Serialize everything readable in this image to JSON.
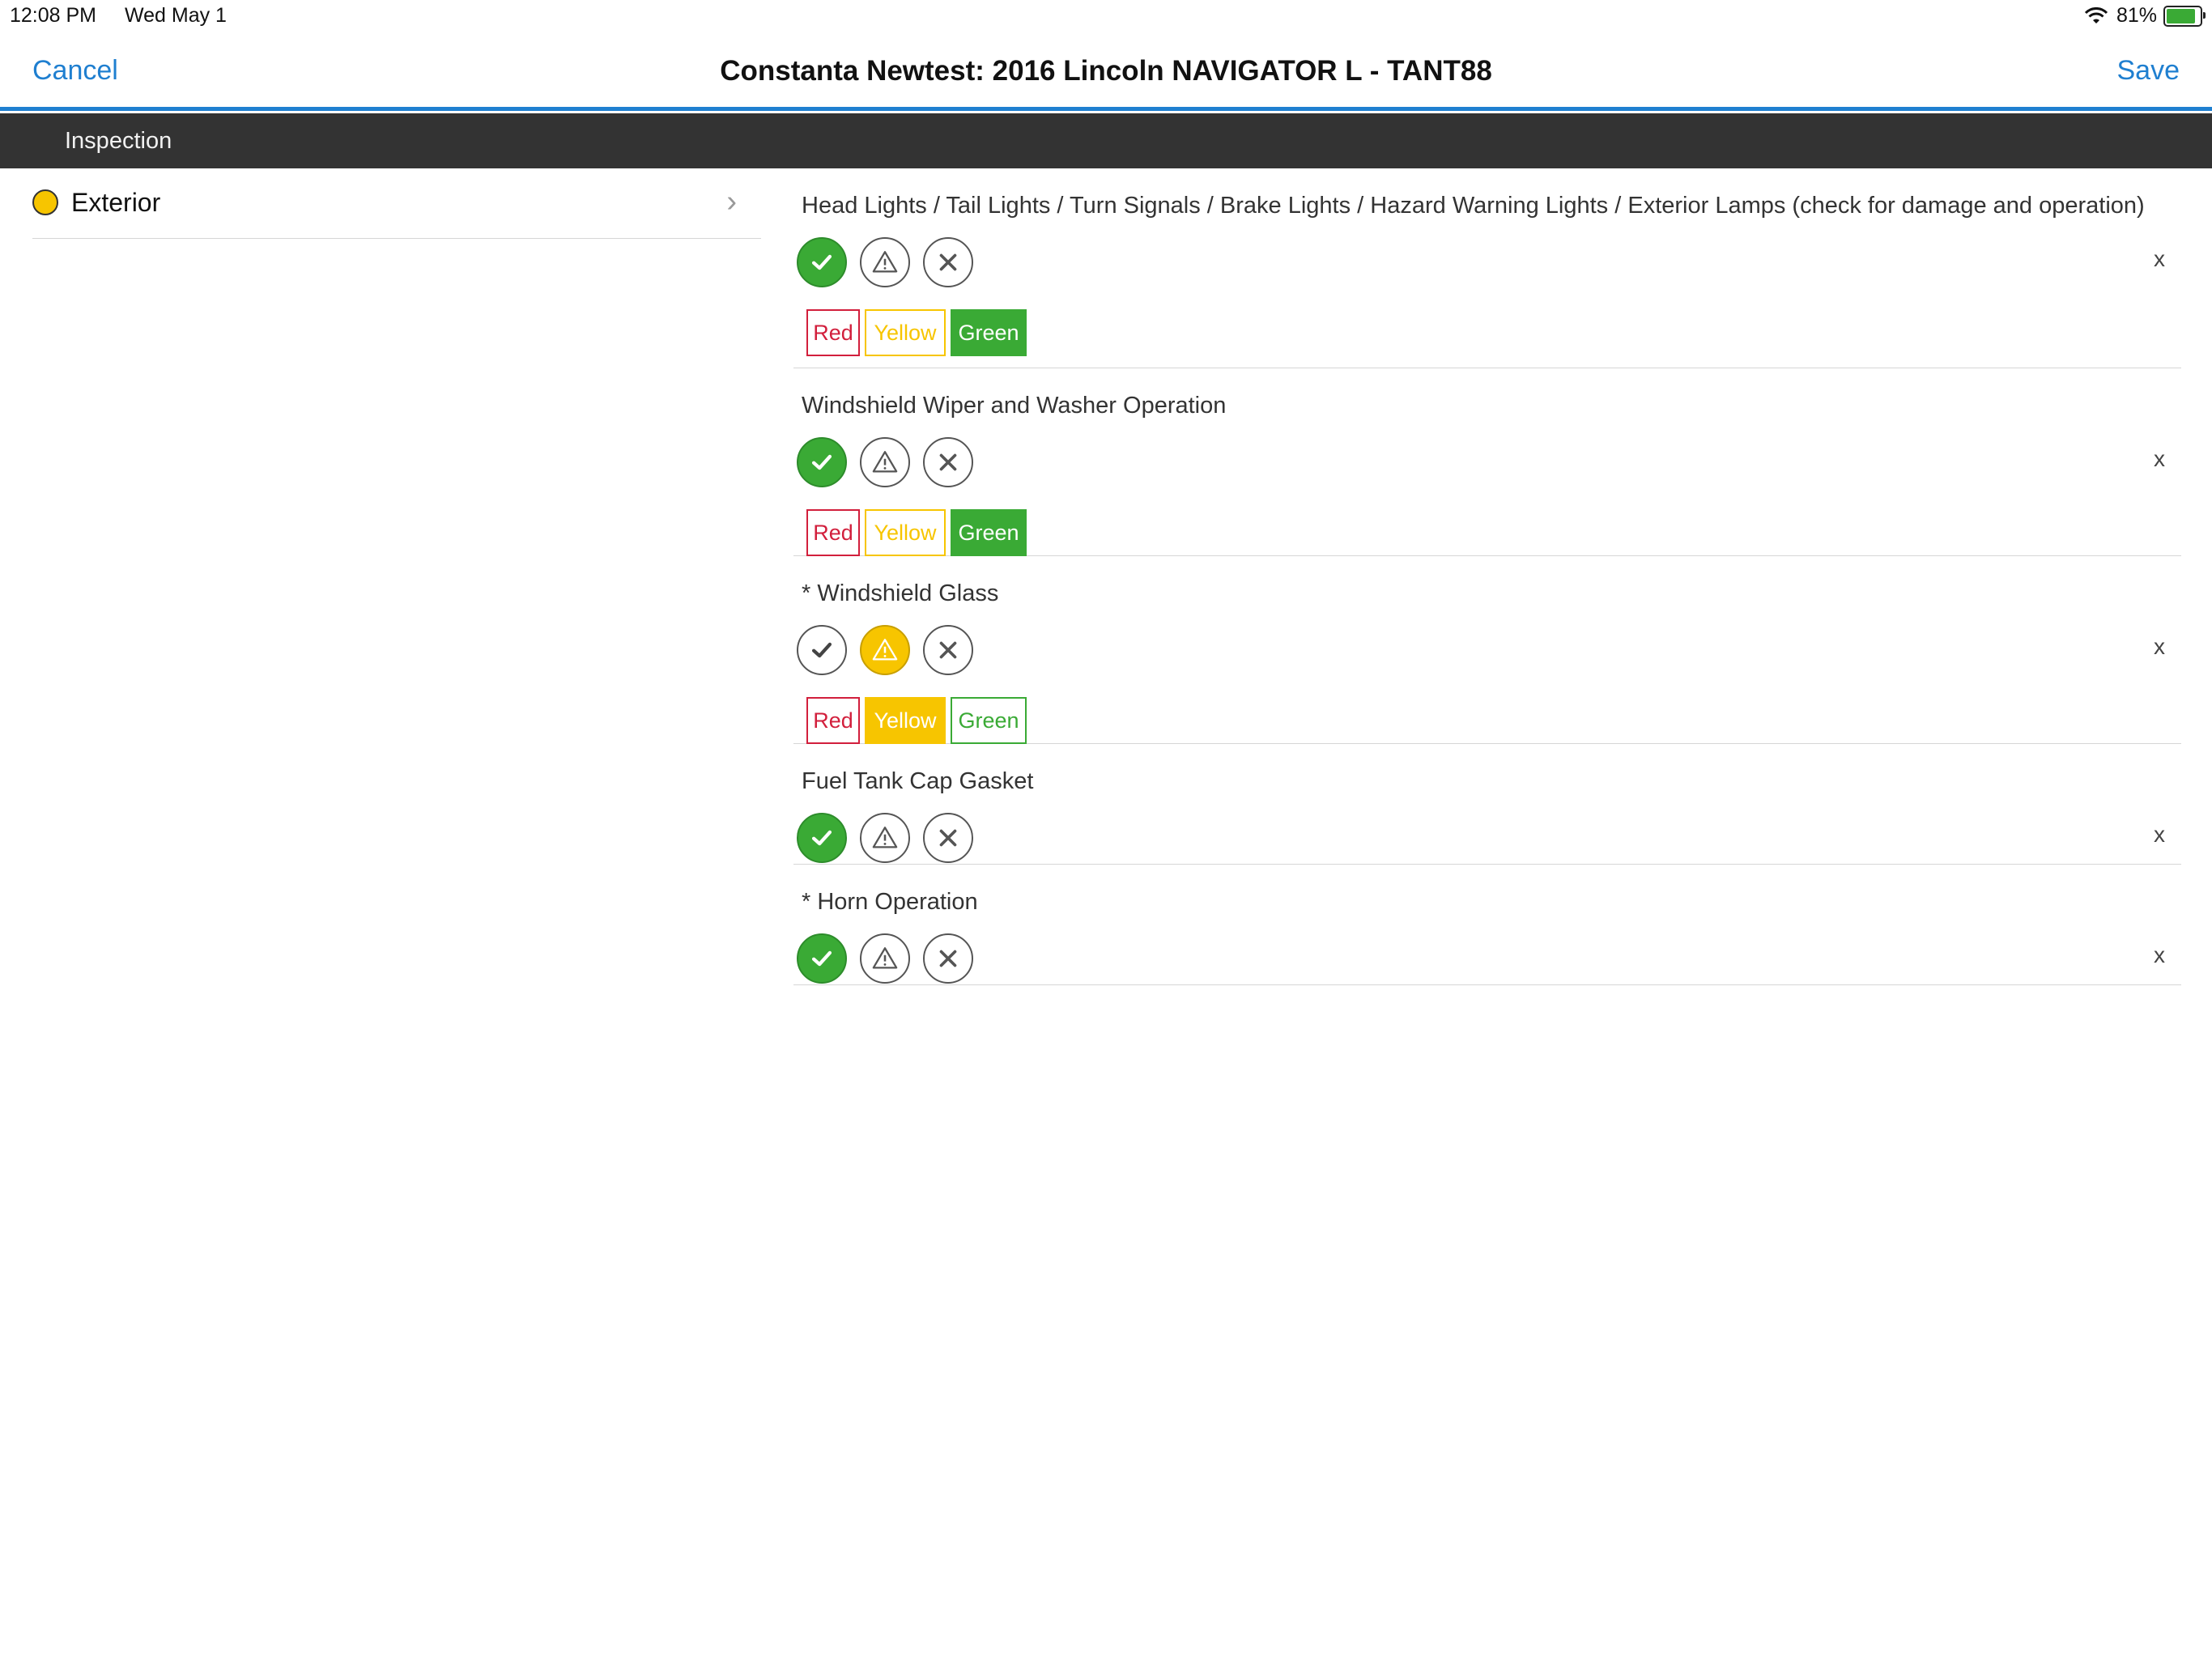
{
  "status": {
    "time": "12:08 PM",
    "date": "Wed May 1",
    "battery": "81%"
  },
  "nav": {
    "cancel": "Cancel",
    "title": "Constanta Newtest: 2016 Lincoln NAVIGATOR L - TANT88",
    "save": "Save"
  },
  "section": {
    "title": "Inspection"
  },
  "sidebar": {
    "items": [
      {
        "label": "Exterior",
        "status_color": "#f7c500"
      }
    ]
  },
  "items": [
    {
      "title": "Head Lights / Tail Lights / Turn Signals / Brake Lights / Hazard Warning Lights / Exterior Lamps (check for damage and operation)",
      "status": "ok",
      "remove": "x",
      "levels": {
        "red": "Red",
        "yellow": "Yellow",
        "green": "Green",
        "selected": "green"
      }
    },
    {
      "title": "Windshield Wiper and Washer Operation",
      "status": "ok",
      "remove": "x",
      "levels": {
        "red": "Red",
        "yellow": "Yellow",
        "green": "Green",
        "selected": "green"
      }
    },
    {
      "title": "* Windshield Glass",
      "status": "warn",
      "remove": "x",
      "levels": {
        "red": "Red",
        "yellow": "Yellow",
        "green": "Green",
        "selected": "yellow"
      }
    },
    {
      "title": "Fuel Tank Cap Gasket",
      "status": "ok",
      "remove": "x"
    },
    {
      "title": "* Horn Operation",
      "status": "ok",
      "remove": "x"
    }
  ],
  "colors": {
    "accent": "#1f7fd0",
    "ok": "#3aaa35",
    "warn": "#f7c500",
    "fail": "#d21f3c",
    "section_bar": "#333333"
  }
}
